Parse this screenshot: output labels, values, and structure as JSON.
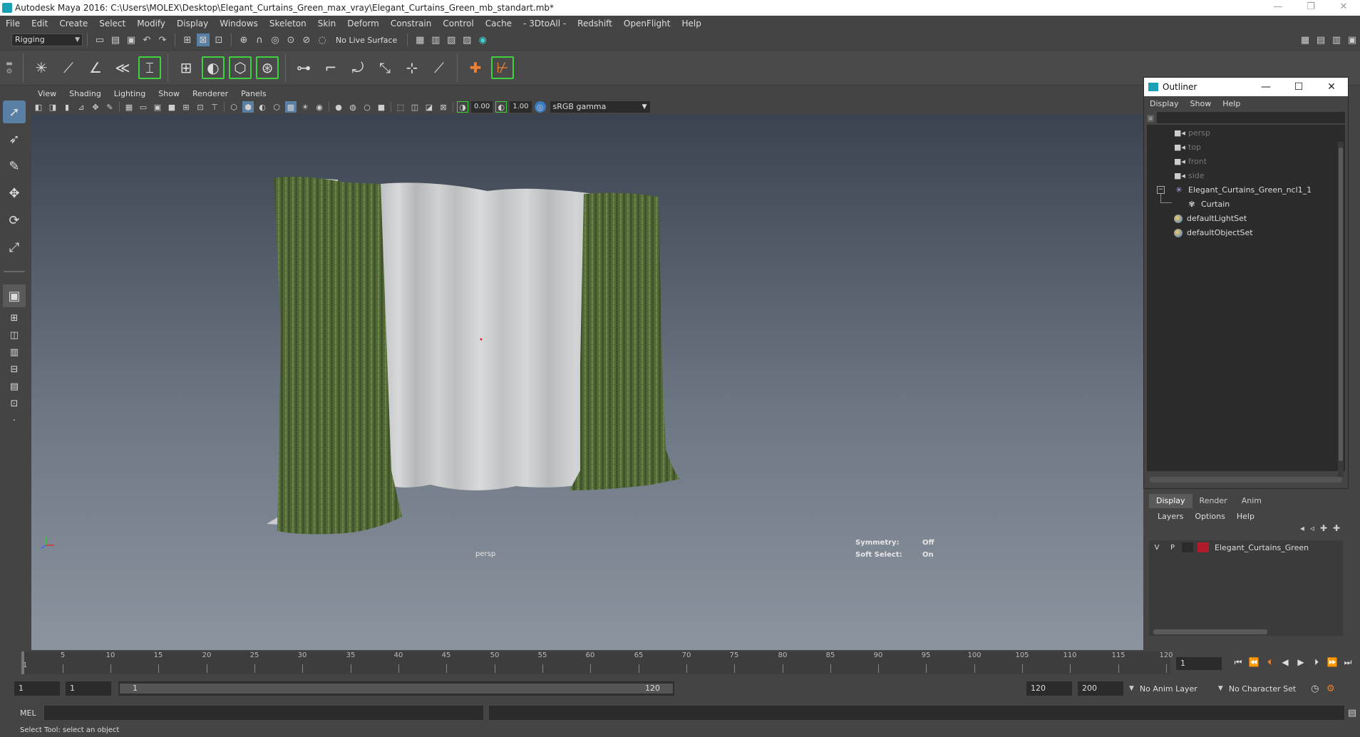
{
  "titlebar": {
    "title": "Autodesk Maya 2016: C:\\Users\\MOLEX\\Desktop\\Elegant_Curtains_Green_max_vray\\Elegant_Curtains_Green_mb_standart.mb*",
    "controls": [
      "—",
      "❐",
      "✕"
    ]
  },
  "menubar": [
    "File",
    "Edit",
    "Create",
    "Select",
    "Modify",
    "Display",
    "Windows",
    "Skeleton",
    "Skin",
    "Deform",
    "Constrain",
    "Control",
    "Cache",
    "- 3DtoAll -",
    "Redshift",
    "OpenFlight",
    "Help"
  ],
  "statusline": {
    "menuset": "Rigging",
    "live_surface": "No Live Surface"
  },
  "panel": {
    "menus": [
      "View",
      "Shading",
      "Lighting",
      "Show",
      "Renderer",
      "Panels"
    ],
    "exposure": "0.00",
    "gamma": "1.00",
    "colorspace": "sRGB gamma"
  },
  "viewport": {
    "camera": "persp",
    "symmetry_label": "Symmetry:",
    "symmetry_value": "Off",
    "soft_select_label": "Soft Select:",
    "soft_select_value": "On",
    "colors": {
      "curtain_green": "#556b3a",
      "sheer_white": "#c9cbcc"
    }
  },
  "outliner": {
    "title": "Outliner",
    "menus": [
      "Display",
      "Show",
      "Help"
    ],
    "items": [
      {
        "label": "persp",
        "dim": true,
        "icon": "camera-icon"
      },
      {
        "label": "top",
        "dim": true,
        "icon": "camera-icon"
      },
      {
        "label": "front",
        "dim": true,
        "icon": "camera-icon"
      },
      {
        "label": "side",
        "dim": true,
        "icon": "camera-icon"
      },
      {
        "label": "Elegant_Curtains_Green_ncl1_1",
        "dim": false,
        "icon": "nucleus-icon"
      },
      {
        "label": "Curtain",
        "dim": false,
        "icon": "ncloth-icon"
      },
      {
        "label": "defaultLightSet",
        "dim": false,
        "icon": "set-icon"
      },
      {
        "label": "defaultObjectSet",
        "dim": false,
        "icon": "set-icon"
      }
    ]
  },
  "layer_editor": {
    "tabs": [
      "Display",
      "Render",
      "Anim"
    ],
    "active_tab": "Display",
    "menus": [
      "Layers",
      "Options",
      "Help"
    ],
    "layers": [
      {
        "v": "V",
        "p": "P",
        "name": "Elegant_Curtains_Green",
        "color": "#b01a2a"
      }
    ]
  },
  "timeline": {
    "ticks": [
      "5",
      "10",
      "15",
      "20",
      "25",
      "30",
      "35",
      "40",
      "45",
      "50",
      "55",
      "60",
      "65",
      "70",
      "75",
      "80",
      "85",
      "90",
      "95",
      "100",
      "105",
      "110",
      "115",
      "120"
    ],
    "first_label": "1",
    "current_frame": "1"
  },
  "range": {
    "start": "1",
    "playback_start": "1",
    "range_start": "1",
    "range_end": "120",
    "playback_end": "120",
    "end": "200",
    "anim_layer": "No Anim Layer",
    "character_set": "No Character Set"
  },
  "cmdline": {
    "label": "MEL"
  },
  "helpline": {
    "text": "Select Tool: select an object"
  }
}
